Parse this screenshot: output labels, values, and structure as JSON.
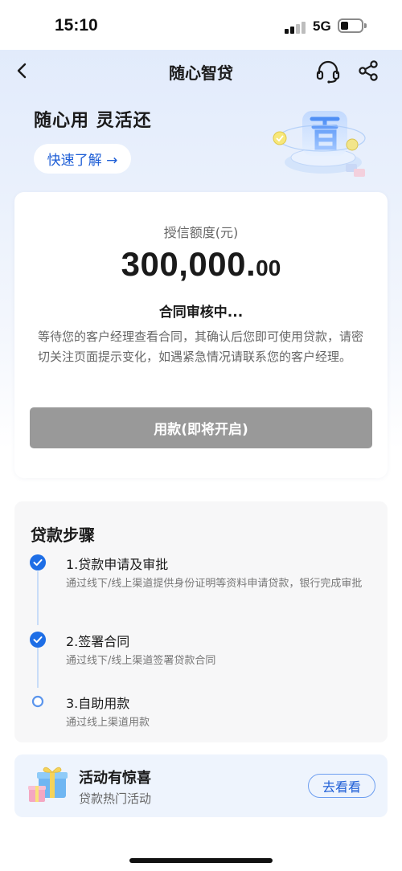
{
  "status_bar": {
    "time": "15:10",
    "network": "5G"
  },
  "nav": {
    "title": "随心智贷"
  },
  "hero": {
    "slogan": "随心用 灵活还",
    "learn_button": "快速了解 →"
  },
  "credit_card": {
    "label": "授信额度(元)",
    "amount_integer": "300,000.",
    "amount_decimal": "00",
    "status_title": "合同审核中...",
    "status_description": "等待您的客户经理查看合同，其确认后您即可使用贷款，请密切关注页面提示变化，如遇紧急情况请联系您的客户经理。",
    "use_button": "用款(即将开启)"
  },
  "steps": {
    "title": "贷款步骤",
    "items": [
      {
        "name": "1.贷款申请及审批",
        "description": "通过线下/线上渠道提供身份证明等资料申请贷款，银行完成审批",
        "done": true
      },
      {
        "name": "2.签署合同",
        "description": "通过线下/线上渠道签署贷款合同",
        "done": true
      },
      {
        "name": "3.自助用款",
        "description": "通过线上渠道用款",
        "done": false
      }
    ]
  },
  "promo": {
    "title": "活动有惊喜",
    "subtitle": "贷款热门活动",
    "button": "去看看"
  },
  "colors": {
    "accent": "#1e5ed6",
    "step_done": "#1e6ee6",
    "disabled_button": "#999999"
  },
  "icons": {
    "back": "chevron-left-icon",
    "support": "headset-icon",
    "share": "share-icon",
    "step_done": "check-circle-icon",
    "step_pending": "empty-circle-icon",
    "promo": "gift-icon"
  }
}
